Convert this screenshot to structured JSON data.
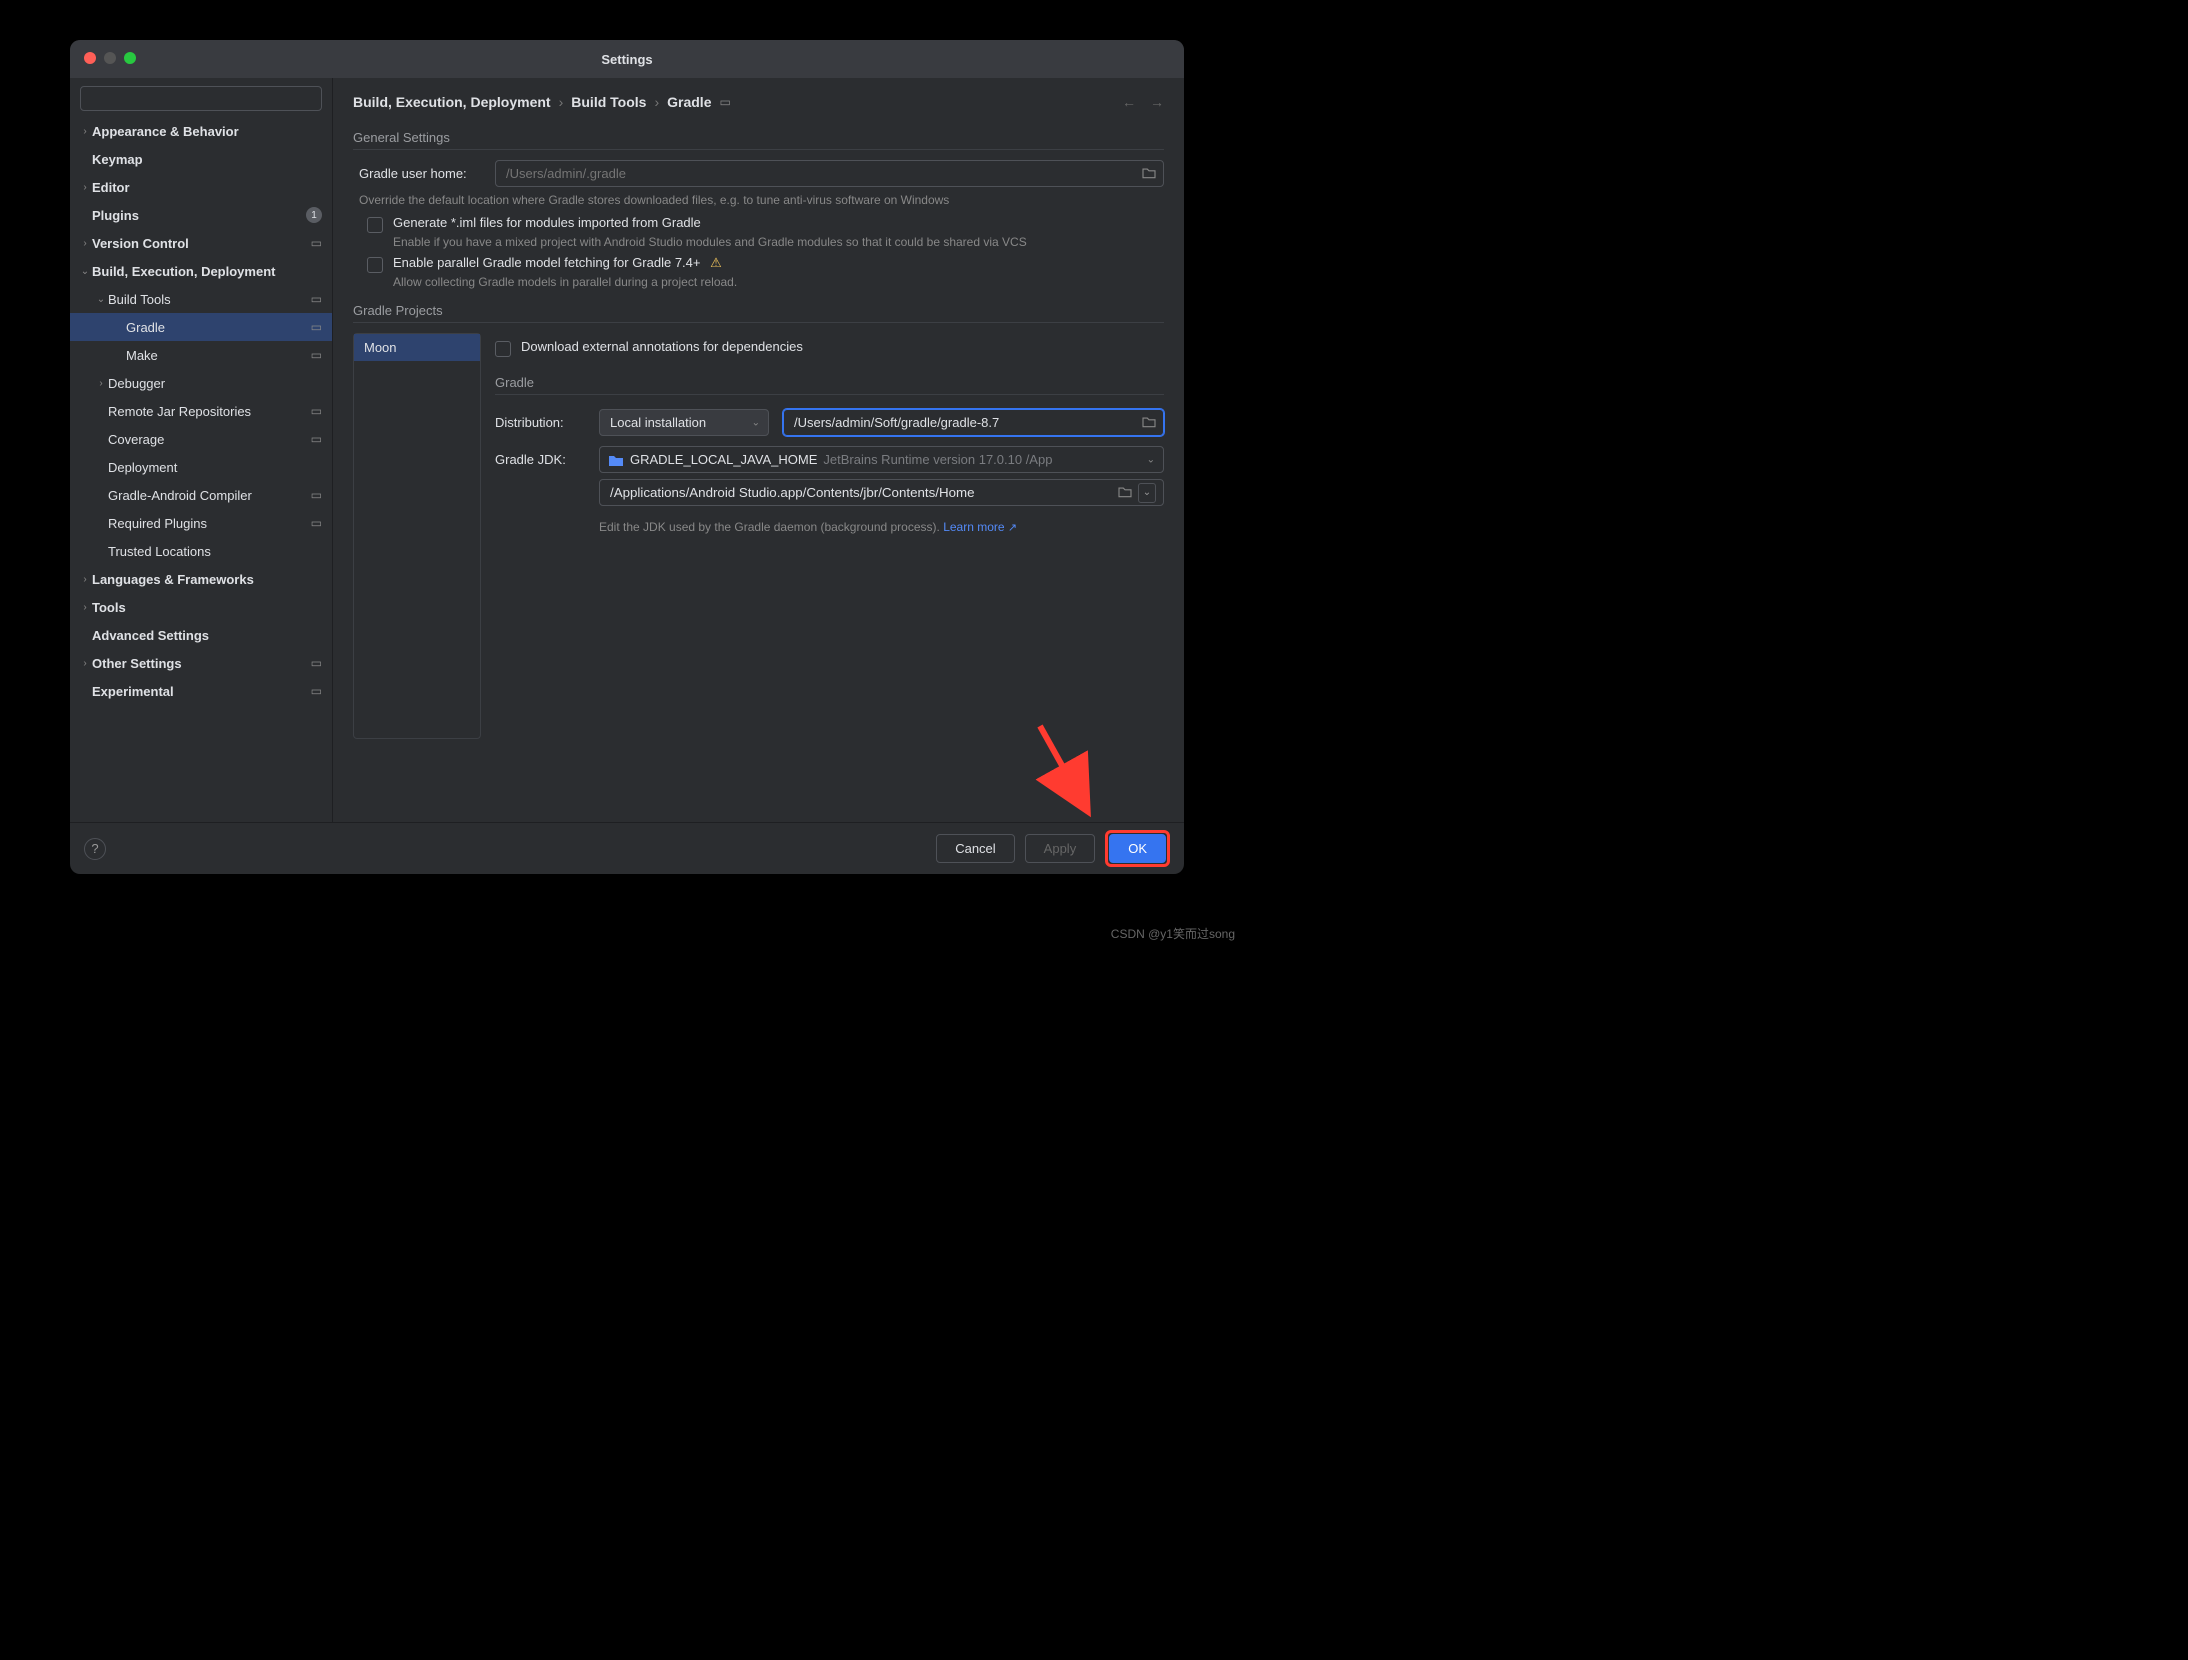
{
  "window": {
    "title": "Settings"
  },
  "search": {
    "placeholder": ""
  },
  "sidebar": {
    "items": [
      {
        "label": "Appearance & Behavior",
        "chevron": "›",
        "indent": 0,
        "bold": true
      },
      {
        "label": "Keymap",
        "chevron": "",
        "indent": 0,
        "bold": true
      },
      {
        "label": "Editor",
        "chevron": "›",
        "indent": 0,
        "bold": true
      },
      {
        "label": "Plugins",
        "chevron": "",
        "indent": 0,
        "bold": true,
        "badge": "1"
      },
      {
        "label": "Version Control",
        "chevron": "›",
        "indent": 0,
        "bold": true,
        "box": true
      },
      {
        "label": "Build, Execution, Deployment",
        "chevron": "⌄",
        "indent": 0,
        "bold": true
      },
      {
        "label": "Build Tools",
        "chevron": "⌄",
        "indent": 1,
        "bold": false,
        "box": true
      },
      {
        "label": "Gradle",
        "chevron": "",
        "indent": 2,
        "bold": false,
        "box": true,
        "selected": true
      },
      {
        "label": "Make",
        "chevron": "",
        "indent": 2,
        "bold": false,
        "box": true
      },
      {
        "label": "Debugger",
        "chevron": "›",
        "indent": 1,
        "bold": false
      },
      {
        "label": "Remote Jar Repositories",
        "chevron": "",
        "indent": 1,
        "bold": false,
        "box": true
      },
      {
        "label": "Coverage",
        "chevron": "",
        "indent": 1,
        "bold": false,
        "box": true
      },
      {
        "label": "Deployment",
        "chevron": "",
        "indent": 1,
        "bold": false
      },
      {
        "label": "Gradle-Android Compiler",
        "chevron": "",
        "indent": 1,
        "bold": false,
        "box": true
      },
      {
        "label": "Required Plugins",
        "chevron": "",
        "indent": 1,
        "bold": false,
        "box": true
      },
      {
        "label": "Trusted Locations",
        "chevron": "",
        "indent": 1,
        "bold": false
      },
      {
        "label": "Languages & Frameworks",
        "chevron": "›",
        "indent": 0,
        "bold": true
      },
      {
        "label": "Tools",
        "chevron": "›",
        "indent": 0,
        "bold": true
      },
      {
        "label": "Advanced Settings",
        "chevron": "",
        "indent": 0,
        "bold": true
      },
      {
        "label": "Other Settings",
        "chevron": "›",
        "indent": 0,
        "bold": true,
        "box": true
      },
      {
        "label": "Experimental",
        "chevron": "",
        "indent": 0,
        "bold": true,
        "box": true
      }
    ]
  },
  "breadcrumb": {
    "crumb1": "Build, Execution, Deployment",
    "crumb2": "Build Tools",
    "crumb3": "Gradle"
  },
  "general": {
    "title": "General Settings",
    "user_home_label": "Gradle user home:",
    "user_home_placeholder": "/Users/admin/.gradle",
    "user_home_help": "Override the default location where Gradle stores downloaded files, e.g. to tune anti-virus software on Windows",
    "iml_label": "Generate *.iml files for modules imported from Gradle",
    "iml_help": "Enable if you have a mixed project with Android Studio modules and Gradle modules so that it could be shared via VCS",
    "parallel_label": "Enable parallel Gradle model fetching for Gradle 7.4+",
    "parallel_help": "Allow collecting Gradle models in parallel during a project reload."
  },
  "projects": {
    "title": "Gradle Projects",
    "items": [
      {
        "name": "Moon"
      }
    ],
    "download_ext": "Download external annotations for dependencies",
    "gradle_title": "Gradle",
    "dist_label": "Distribution:",
    "dist_value": "Local installation",
    "dist_path": "/Users/admin/Soft/gradle/gradle-8.7",
    "jdk_label": "Gradle JDK:",
    "jdk_value": "GRADLE_LOCAL_JAVA_HOME",
    "jdk_detail": "JetBrains Runtime version 17.0.10 /App",
    "jdk_path": "/Applications/Android Studio.app/Contents/jbr/Contents/Home",
    "edit_jdk_text": "Edit the JDK used by the Gradle daemon (background process).",
    "learn_more": "Learn more"
  },
  "footer": {
    "cancel": "Cancel",
    "apply": "Apply",
    "ok": "OK"
  },
  "watermark": "CSDN @y1笑而过song"
}
